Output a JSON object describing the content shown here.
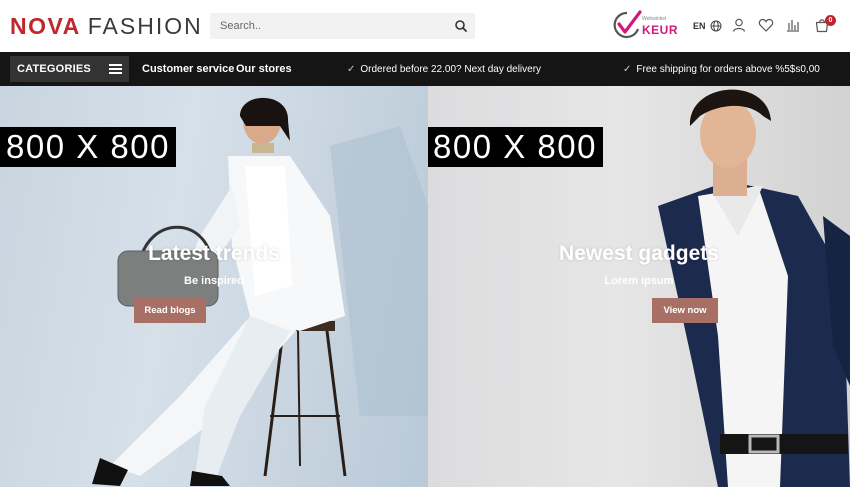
{
  "header": {
    "logo_brand": "NOVA",
    "logo_word": "FASHION",
    "search_placeholder": "Search..",
    "trust_badge": {
      "small": "Webwinkel",
      "word": "KEUR"
    },
    "language": "EN",
    "cart_count": "0",
    "icons": [
      "search-icon",
      "globe-icon",
      "user-icon",
      "heart-icon",
      "chart-icon",
      "cart-icon"
    ]
  },
  "nav": {
    "categories_label": "CATEGORIES",
    "links": [
      "Customer service",
      "Our stores"
    ],
    "usps": [
      "Ordered before 22.00? Next day delivery",
      "Free shipping for orders above %5$s0,00"
    ]
  },
  "banners": [
    {
      "placeholder": "800 X 800",
      "title": "Latest trends",
      "subtitle": "Be inspired",
      "button": "Read blogs"
    },
    {
      "placeholder": "800 X 800",
      "title": "Newest gadgets",
      "subtitle": "Lorem ipsum",
      "button": "View now"
    }
  ],
  "colors": {
    "brand": "#c0272d",
    "navbar": "#151515",
    "button": "#a87065",
    "keur": "#d2187a"
  }
}
